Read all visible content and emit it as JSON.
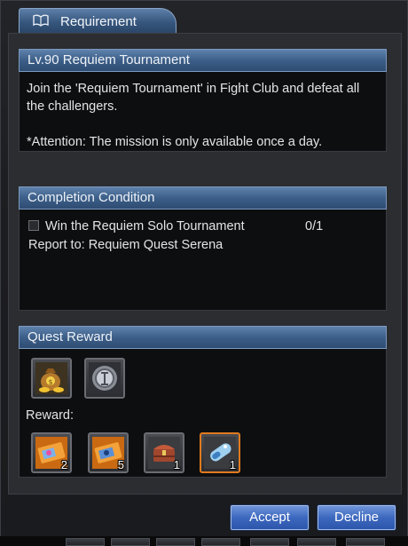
{
  "window": {
    "title": "Requirement",
    "title_icon": "book-icon"
  },
  "description": {
    "header": "Lv.90 Requiem Tournament",
    "text": "Join the 'Requiem Tournament' in Fight Club and defeat all the challengers.",
    "attention": "*Attention: The mission is only available once a day."
  },
  "completion": {
    "header": "Completion Condition",
    "condition_label": "Win the Requiem Solo Tournament",
    "condition_progress": "0/1",
    "report_to": "Report to: Requiem Quest Serena"
  },
  "reward": {
    "header": "Quest Reward",
    "base_items": [
      {
        "icon": "money-bag-icon"
      },
      {
        "icon": "experience-coin-icon"
      }
    ],
    "reward_label": "Reward:",
    "items": [
      {
        "icon": "orange-ticket-icon",
        "count": "2"
      },
      {
        "icon": "blue-ticket-icon",
        "count": "5"
      },
      {
        "icon": "treasure-chest-icon",
        "count": "1"
      },
      {
        "icon": "crystal-capsule-icon",
        "count": "1"
      }
    ]
  },
  "buttons": {
    "accept": "Accept",
    "decline": "Decline"
  },
  "colors": {
    "header_blue": "#3c5e88",
    "button_blue": "#3d68bf",
    "selected_border": "#e07a1e"
  }
}
